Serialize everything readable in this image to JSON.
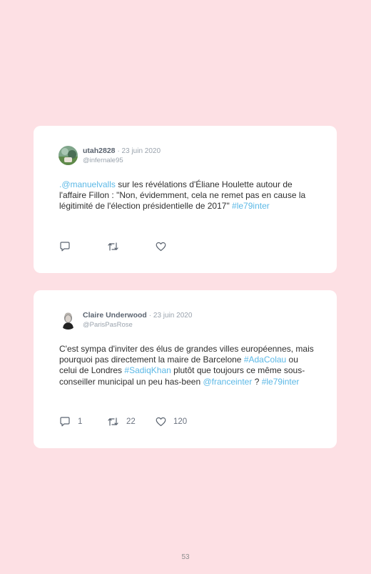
{
  "tweets": [
    {
      "name": "utah2828",
      "date": "· 23 juin 2020",
      "handle": "@infernale95",
      "text_parts": [
        {
          "text": ".@manuelvalls",
          "tag": true
        },
        {
          "text": " sur les révélations d'Éliane Houlette autour de l'affaire Fillon : \"Non, évidemment, cela ne remet pas en cause la légitimité de l'élection présidentielle de 2017\" ",
          "tag": false
        },
        {
          "text": "#le79inter",
          "tag": true
        }
      ],
      "replies": "",
      "retweets": "",
      "likes": ""
    },
    {
      "name": "Claire Underwood",
      "date": "· 23 juin 2020",
      "handle": "@ParisPasRose",
      "text_parts": [
        {
          "text": "C'est sympa d'inviter des élus de grandes villes européennes, mais pourquoi pas directement la maire de Barcelone ",
          "tag": false
        },
        {
          "text": "#AdaColau",
          "tag": true
        },
        {
          "text": " ou celui de Londres ",
          "tag": false
        },
        {
          "text": "#SadiqKhan",
          "tag": true
        },
        {
          "text": " plutôt que toujours ce même sous-conseiller municipal un peu has-been ",
          "tag": false
        },
        {
          "text": "@franceinter",
          "tag": true
        },
        {
          "text": " ? ",
          "tag": false
        },
        {
          "text": "#le79inter",
          "tag": true
        }
      ],
      "replies": "1",
      "retweets": "22",
      "likes": "120"
    }
  ],
  "icons": {
    "reply": "reply-icon",
    "retweet": "retweet-icon",
    "like": "heart-icon"
  },
  "colors": {
    "background": "#fde0e4",
    "card": "#ffffff",
    "link": "#5bb8e6",
    "name": "#5b6470",
    "muted": "#9aa3ad"
  },
  "page_number": "53"
}
